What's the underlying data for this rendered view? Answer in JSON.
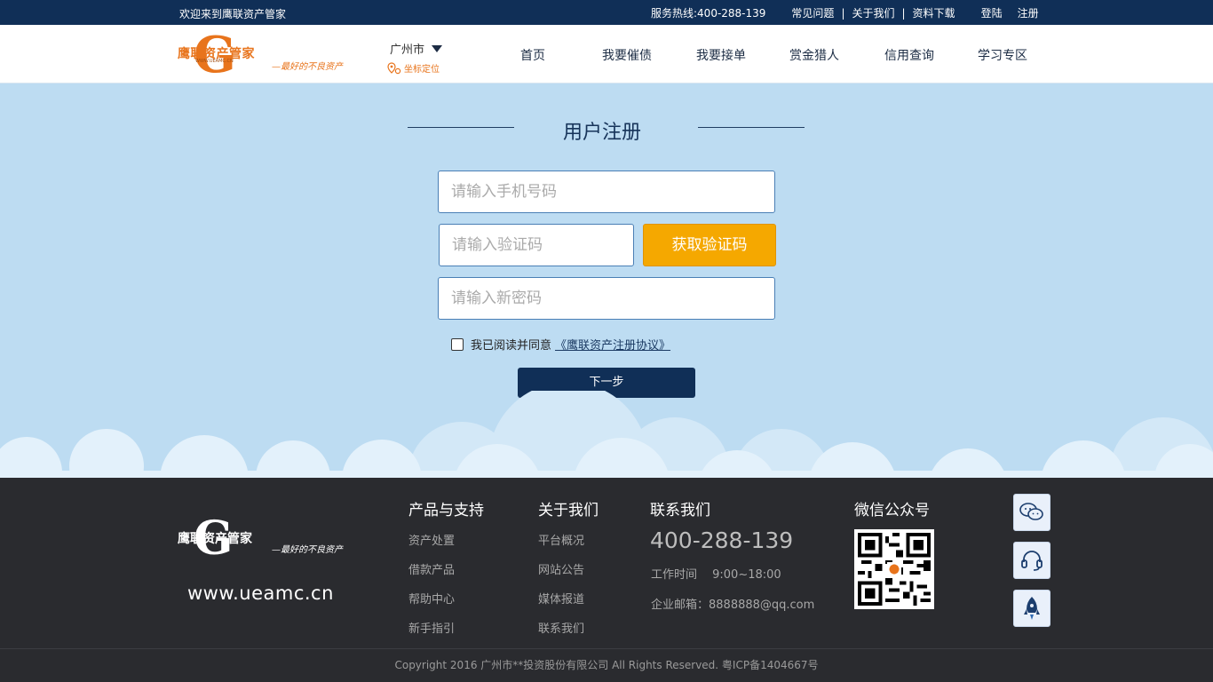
{
  "topbar": {
    "welcome": "欢迎来到鹰联资产管家",
    "hotline": "服务热线:400-288-139",
    "faq": "常见问题",
    "about": "关于我们",
    "download": "资料下载",
    "separator": "|",
    "login": "登陆",
    "register": "注册"
  },
  "header": {
    "logo_brand": "鹰联资产管家",
    "logo_url": "WWW.UEAMC.CN",
    "logo_slogan": "—最好的不良资产",
    "city": "广州市",
    "locate": "坐标定位",
    "nav": [
      "首页",
      "我要催债",
      "我要接单",
      "赏金猎人",
      "信用查询",
      "学习专区"
    ]
  },
  "form": {
    "title": "用户注册",
    "phone_placeholder": "请输入手机号码",
    "code_placeholder": "请输入验证码",
    "get_code": "获取验证码",
    "password_placeholder": "请输入新密码",
    "agree_text": "我已阅读并同意",
    "agree_link": "《鹰联资产注册协议》",
    "next": "下一步"
  },
  "footer": {
    "logo_brand": "鹰联资产管家",
    "logo_slogan": "—最好的不良资产",
    "site": "www.ueamc.cn",
    "products": {
      "title": "产品与支持",
      "links": [
        "资产处置",
        "借款产品",
        "帮助中心",
        "新手指引"
      ]
    },
    "about": {
      "title": "关于我们",
      "links": [
        "平台概况",
        "网站公告",
        "媒体报道",
        "联系我们"
      ]
    },
    "contact": {
      "title": "联系我们",
      "phone": "400-288-139",
      "hours": "工作时间　 9:00~18:00",
      "email": "企业邮箱：8888888@qq.com"
    },
    "wechat": {
      "title": "微信公众号"
    },
    "copyright": "Copyright 2016 广州市**投资股份有限公司 All Rights Reserved. 粤ICP备1404667号"
  },
  "colors": {
    "navy": "#102f57",
    "accent": "#f5a800",
    "logo_orange": "#e8741c",
    "page_bg": "#bddcf2",
    "footer_bg": "#2a2b2f"
  },
  "icons": {
    "side_buttons": [
      "wechat-icon",
      "headset-icon",
      "rocket-icon"
    ]
  }
}
